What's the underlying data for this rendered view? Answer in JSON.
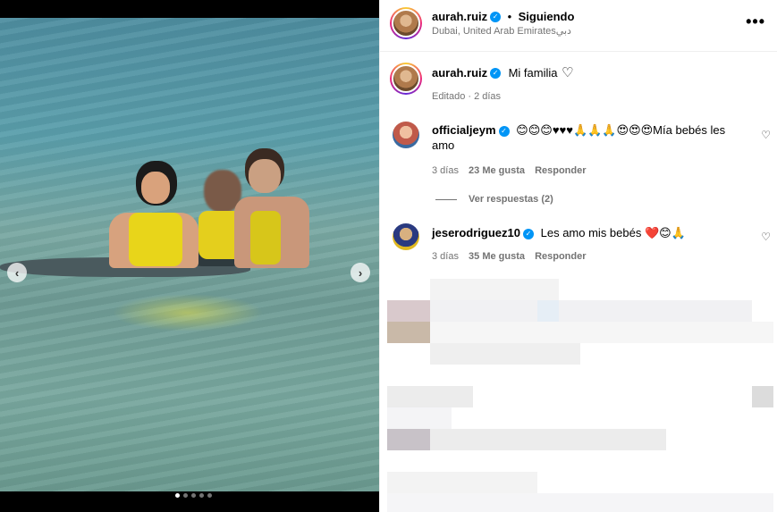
{
  "post": {
    "username": "aurah.ruiz",
    "follow_status": "Siguiendo",
    "separator": "•",
    "location": "Dubai, United Arab Emiratesدبي",
    "more_icon": "more-horizontal-icon",
    "caption": "Mi familia",
    "caption_heart": "♡",
    "edited": "Editado · 2 días"
  },
  "comments": [
    {
      "username": "officialjeym",
      "text_line1": "😊😊😊♥♥♥🙏🙏🙏😍😍😍Mía bebés les",
      "text_line2": "amo",
      "time": "3 días",
      "likes": "23 Me gusta",
      "reply": "Responder",
      "view_replies": "Ver respuestas (2)"
    },
    {
      "username": "jeserodriguez10",
      "text_line1": "Les amo mis bebés ❤️😊🙏",
      "time": "3 días",
      "likes": "35 Me gusta",
      "reply": "Responder"
    }
  ],
  "media": {
    "prev_label": "‹",
    "next_label": "›"
  },
  "colors": {
    "verified": "#0095f6",
    "muted": "#737373"
  }
}
